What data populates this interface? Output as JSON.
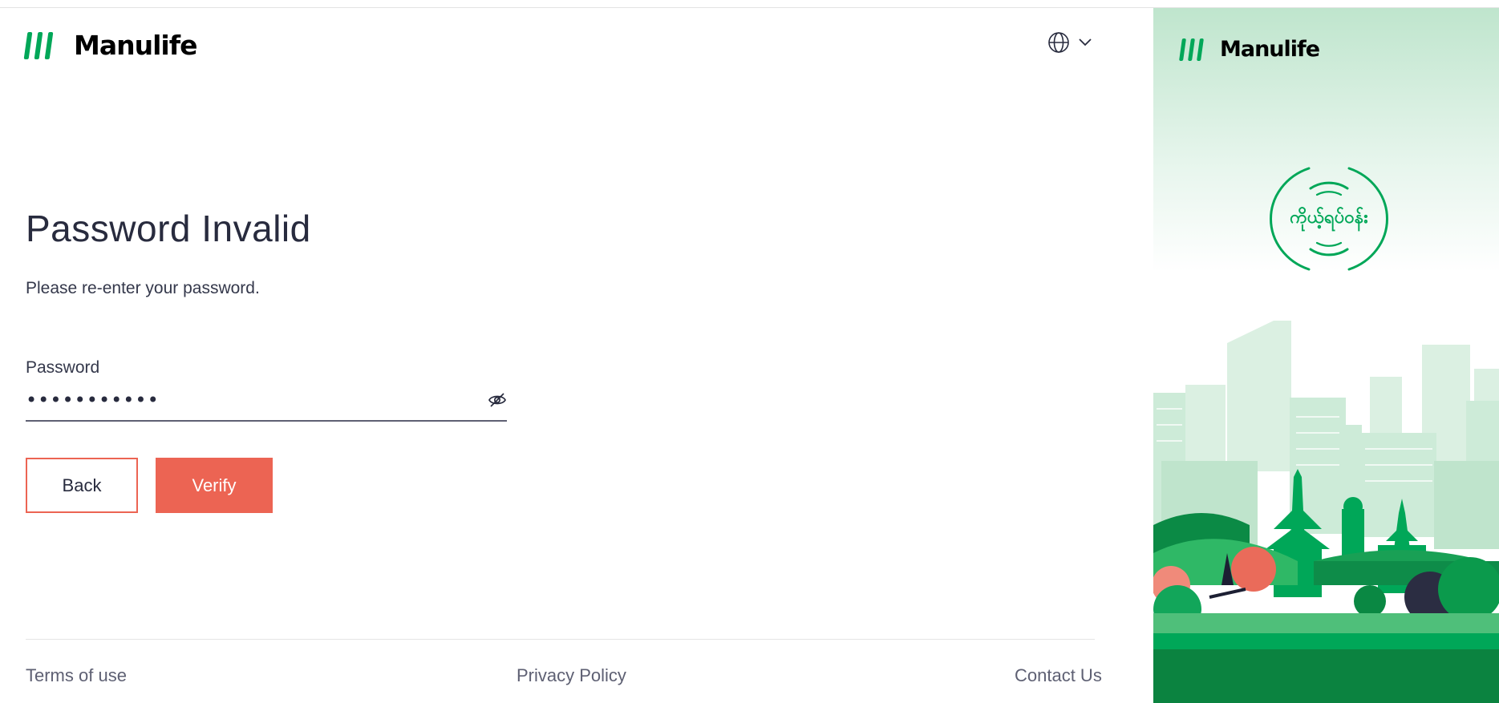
{
  "brand": {
    "name": "Manulife",
    "color": "#00a758"
  },
  "header": {
    "language_icon": "globe-icon",
    "dropdown_icon": "chevron-down-icon"
  },
  "main": {
    "title": "Password Invalid",
    "subtitle": "Please re-enter your password.",
    "password": {
      "label": "Password",
      "value": "•••••••••••",
      "toggle_icon": "eye-slash-icon"
    },
    "buttons": {
      "back": "Back",
      "verify": "Verify"
    },
    "accent_color": "#ec6453"
  },
  "footer": {
    "terms": "Terms of use",
    "privacy": "Privacy Policy",
    "contact": "Contact Us"
  },
  "side_panel": {
    "brand_name": "Manulife",
    "badge_text": "ကိုယ့်ရပ်ဝန်း"
  }
}
